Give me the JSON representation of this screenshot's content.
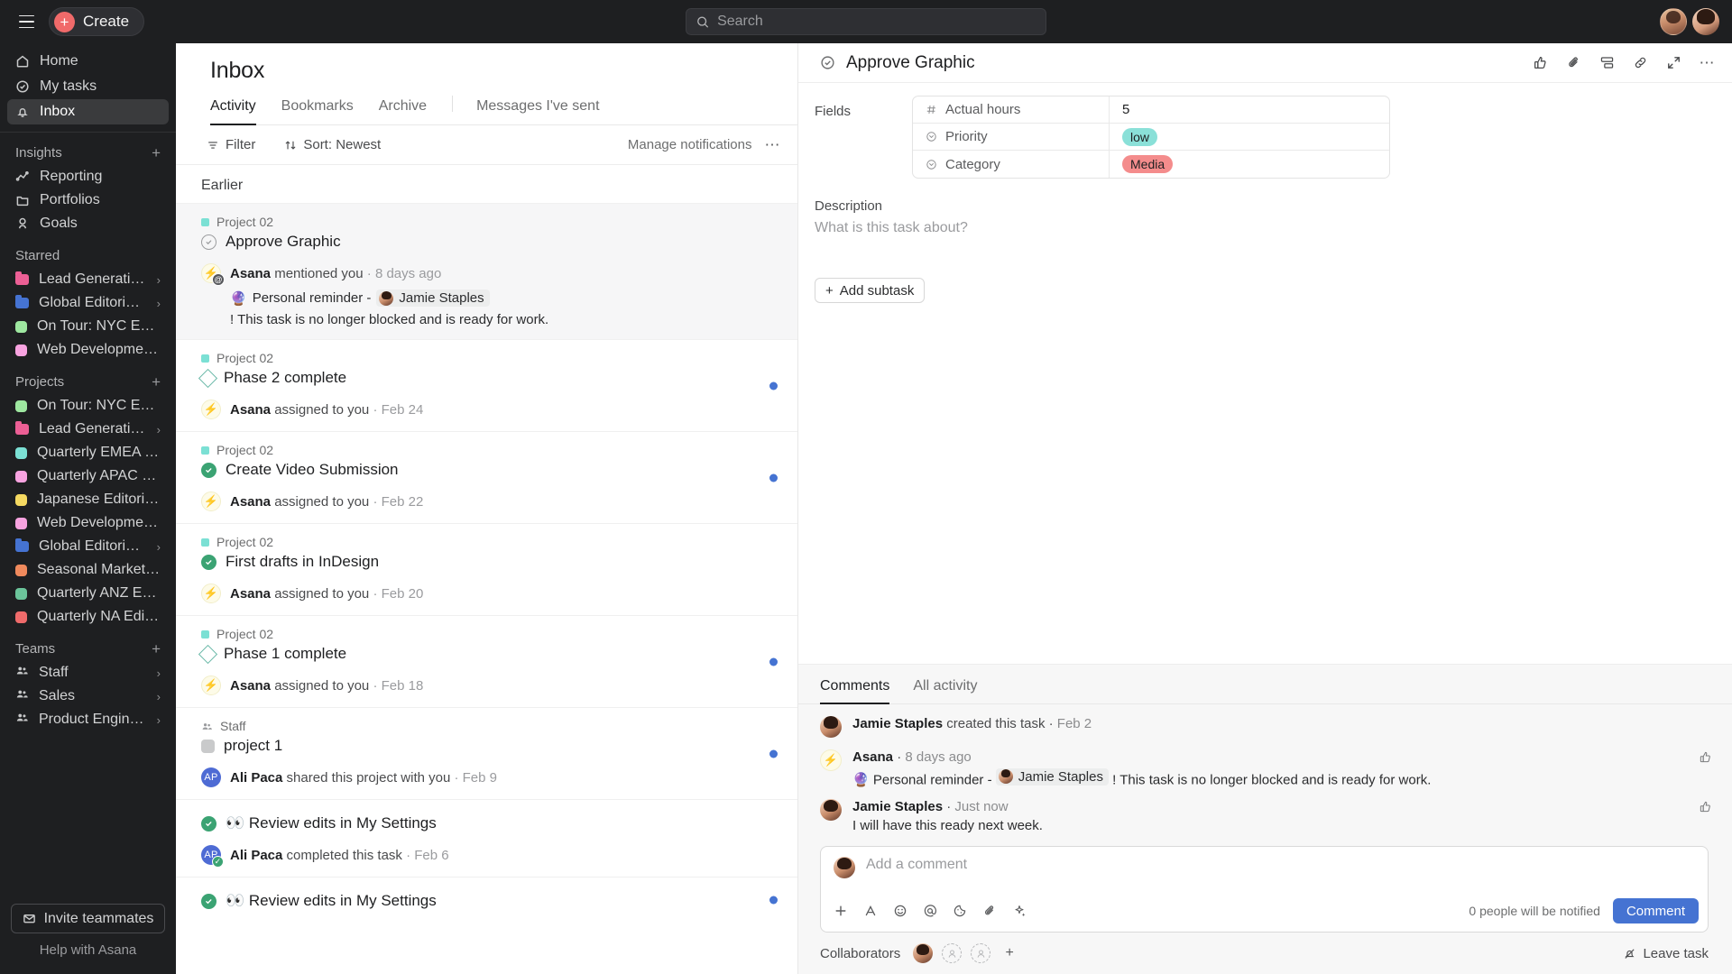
{
  "topbar": {
    "create_label": "Create",
    "menu_icon": "hamburger-icon",
    "search_placeholder": "Search",
    "search_value": ""
  },
  "sidebar": {
    "nav": [
      {
        "label": "Home",
        "icon": "home-icon",
        "active": false
      },
      {
        "label": "My tasks",
        "icon": "check-circle-icon",
        "active": false
      },
      {
        "label": "Inbox",
        "icon": "bell-icon",
        "active": true
      }
    ],
    "insights": {
      "title": "Insights",
      "add_label": "+",
      "items": [
        {
          "label": "Reporting",
          "icon": "chart-line-icon"
        },
        {
          "label": "Portfolios",
          "icon": "folder-icon"
        },
        {
          "label": "Goals",
          "icon": "goal-icon"
        }
      ]
    },
    "starred": {
      "title": "Starred",
      "items": [
        {
          "label": "Lead Generation Ca…",
          "color": "#ec5f95",
          "shape": "folder",
          "chevron": true
        },
        {
          "label": "Global Editorial Cale…",
          "color": "#4573d2",
          "shape": "folder",
          "chevron": true
        },
        {
          "label": "On Tour: NYC Event",
          "color": "#9ee7a0",
          "shape": "dot",
          "chevron": false
        },
        {
          "label": "Web Development Sprint…",
          "color": "#f8a3e0",
          "shape": "dot",
          "chevron": false
        }
      ]
    },
    "projects": {
      "title": "Projects",
      "add_label": "+",
      "items": [
        {
          "label": "On Tour: NYC Event",
          "color": "#9ee7a0",
          "shape": "dot",
          "chevron": false
        },
        {
          "label": "Lead Generation Ca…",
          "color": "#ec5f95",
          "shape": "folder",
          "chevron": true
        },
        {
          "label": "Quarterly EMEA Editorial…",
          "color": "#7be0d4",
          "shape": "dot",
          "chevron": false
        },
        {
          "label": "Quarterly APAC Editorial …",
          "color": "#f8a3e0",
          "shape": "dot",
          "chevron": false
        },
        {
          "label": "Japanese Editorial Calen…",
          "color": "#f5d961",
          "shape": "dot",
          "chevron": false
        },
        {
          "label": "Web Development Sprint…",
          "color": "#f8a3e0",
          "shape": "dot",
          "chevron": false
        },
        {
          "label": "Global Editorial Cale…",
          "color": "#4573d2",
          "shape": "folder",
          "chevron": true
        },
        {
          "label": "Seasonal Marketing Cam…",
          "color": "#f08a5d",
          "shape": "dot",
          "chevron": false
        },
        {
          "label": "Quarterly ANZ Editorial C…",
          "color": "#6bc49a",
          "shape": "dot",
          "chevron": false
        },
        {
          "label": "Quarterly NA Editorial Ca…",
          "color": "#ef6b6b",
          "shape": "dot",
          "chevron": false
        }
      ]
    },
    "teams": {
      "title": "Teams",
      "add_label": "+",
      "items": [
        {
          "label": "Staff",
          "chevron": true
        },
        {
          "label": "Sales",
          "chevron": true
        },
        {
          "label": "Product Engineering",
          "chevron": true
        }
      ]
    },
    "invite_label": "Invite teammates",
    "help_label": "Help with Asana"
  },
  "inbox": {
    "title": "Inbox",
    "tabs": [
      {
        "label": "Activity",
        "active": true
      },
      {
        "label": "Bookmarks",
        "active": false
      },
      {
        "label": "Archive",
        "active": false
      }
    ],
    "tab_right": {
      "label": "Messages I've sent",
      "active": false
    },
    "toolbar": {
      "filter_label": "Filter",
      "sort_label": "Sort: Newest",
      "manage_label": "Manage notifications",
      "more_label": "…"
    },
    "group_label": "Earlier",
    "items": [
      {
        "project": "Project 02",
        "project_color": "#7be0d4",
        "task": "Approve Graphic",
        "task_icon": "circle-check-outline",
        "actor": "Asana",
        "action": "mentioned you",
        "time": "8 days ago",
        "actor_icon": "bolt-icon",
        "has_mention_badge": true,
        "message_prefix": "Personal reminder -",
        "message_emoji": "🔮",
        "mention_name": "Jamie Staples",
        "message_suffix": "! This task is no longer blocked and is ready for work.",
        "selected": true,
        "unread": false
      },
      {
        "project": "Project 02",
        "project_color": "#7be0d4",
        "task": "Phase 2 complete",
        "task_icon": "diamond-outline",
        "actor": "Asana",
        "action": "assigned to you",
        "time": "Feb 24",
        "actor_icon": "bolt-icon",
        "selected": false,
        "unread": true
      },
      {
        "project": "Project 02",
        "project_color": "#7be0d4",
        "task": "Create Video Submission",
        "task_icon": "circle-check-filled",
        "actor": "Asana",
        "action": "assigned to you",
        "time": "Feb 22",
        "actor_icon": "bolt-icon",
        "selected": false,
        "unread": true
      },
      {
        "project": "Project 02",
        "project_color": "#7be0d4",
        "task": "First drafts in InDesign",
        "task_icon": "circle-check-filled",
        "actor": "Asana",
        "action": "assigned to you",
        "time": "Feb 20",
        "actor_icon": "bolt-icon",
        "selected": false,
        "unread": false
      },
      {
        "project": "Project 02",
        "project_color": "#7be0d4",
        "task": "Phase 1 complete",
        "task_icon": "diamond-outline",
        "actor": "Asana",
        "action": "assigned to you",
        "time": "Feb 18",
        "actor_icon": "bolt-icon",
        "selected": false,
        "unread": true
      },
      {
        "team": "Staff",
        "task": "project 1",
        "task_icon": "grey-square",
        "actor": "Ali Paca",
        "action": "shared this project with you",
        "time": "Feb 9",
        "actor_initials": "AP",
        "selected": false,
        "unread": true
      },
      {
        "task": "👀 Review edits in My Settings",
        "task_icon": "circle-check-filled",
        "actor": "Ali Paca",
        "action": "completed this task",
        "time": "Feb 6",
        "actor_initials": "AP",
        "actor_check": true,
        "selected": false,
        "unread": false
      },
      {
        "task": "👀 Review edits in My Settings",
        "task_icon": "circle-check-filled",
        "selected": false,
        "unread": true
      }
    ]
  },
  "detail": {
    "title": "Approve Graphic",
    "title_icon": "circle-check-outline",
    "header_icons": [
      "thumbs-up-icon",
      "paperclip-icon",
      "subtask-icon",
      "link-icon",
      "expand-icon",
      "more-horizontal-icon"
    ],
    "fields_label": "Fields",
    "fields": [
      {
        "name": "Actual hours",
        "icon": "hash-icon",
        "value": "5",
        "type": "text"
      },
      {
        "name": "Priority",
        "icon": "dropdown-circle-icon",
        "value": "low",
        "type": "pill",
        "color": "#8ae0d8"
      },
      {
        "name": "Category",
        "icon": "dropdown-circle-icon",
        "value": "Media",
        "type": "pill",
        "color": "#f48c8c"
      }
    ],
    "description_label": "Description",
    "description_placeholder": "What is this task about?",
    "add_subtask_label": "Add subtask",
    "comment_tabs": [
      {
        "label": "Comments",
        "active": true
      },
      {
        "label": "All activity",
        "active": false
      }
    ],
    "comments": [
      {
        "author": "Jamie Staples",
        "action": "created this task",
        "time": "Feb 2",
        "avatar": "photo",
        "text": "",
        "likeable": false
      },
      {
        "author": "Asana",
        "action": "",
        "time": "8 days ago",
        "avatar": "bolt",
        "emoji": "🔮",
        "text_prefix": "Personal reminder -",
        "mention_name": "Jamie Staples",
        "text_suffix": "! This task is no longer blocked and is ready for work.",
        "likeable": true
      },
      {
        "author": "Jamie Staples",
        "action": "",
        "time": "Just now",
        "avatar": "photo",
        "text": "I will have this ready next week.",
        "likeable": true
      }
    ],
    "composer": {
      "placeholder": "Add a comment",
      "value": "",
      "toolbar_icons": [
        "plus-icon",
        "format-text-icon",
        "emoji-icon",
        "mention-icon",
        "sticker-icon",
        "attach-icon",
        "sparkle-icon"
      ],
      "notified_text": "0 people will be notified",
      "submit_label": "Comment"
    },
    "collaborators": {
      "label": "Collaborators",
      "add_label": "+",
      "leave_label": "Leave task",
      "leave_icon": "bell-slash-icon"
    }
  },
  "colors": {
    "accent_blue": "#4573d2",
    "create_red": "#f06a6a",
    "sidebar_bg": "#1e1f21",
    "unread_dot": "#4573d2"
  }
}
